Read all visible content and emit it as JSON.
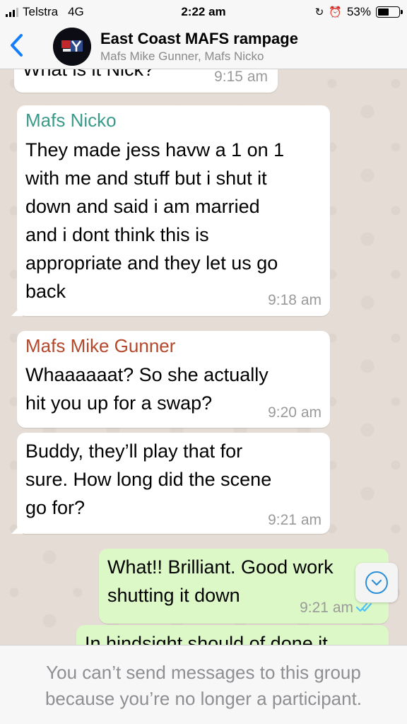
{
  "status_bar": {
    "carrier": "Telstra",
    "network": "4G",
    "time": "2:22 am",
    "battery_percent": "53%",
    "battery_level": 0.53,
    "icons": [
      "signal-icon",
      "rotation-lock-icon",
      "alarm-icon",
      "battery-icon"
    ]
  },
  "header": {
    "back_icon": "chevron-left-icon",
    "title": "East Coast MAFS rampage",
    "members": "Mafs Mike Gunner, Mafs Nicko"
  },
  "messages": [
    {
      "direction": "in",
      "sender": "",
      "text": "What is it Nick?",
      "time": "9:15 am"
    },
    {
      "direction": "in",
      "sender": "Mafs Nicko",
      "sender_color": "#3a9a8a",
      "text": "They made jess havw a 1 on 1\nwith me and stuff but i shut it\ndown and said i am married\nand i dont think this is\nappropriate and they let us go\nback",
      "time": "9:18 am"
    },
    {
      "direction": "in",
      "sender": "Mafs Mike Gunner",
      "sender_color": "#b5472a",
      "text": "Whaaaaaat? So she actually\nhit you up for a swap?",
      "time": "9:20 am"
    },
    {
      "direction": "in",
      "sender": "",
      "text": "Buddy, they’ll play that for\nsure. How long did the scene\ngo for?",
      "time": "9:21 am"
    },
    {
      "direction": "out",
      "sender": "",
      "text": "What!! Brilliant. Good work\nshutting it down",
      "time": "9:21 am",
      "status_icon": "double-check-read-icon"
    },
    {
      "direction": "out",
      "sender": "",
      "text": "In hindsight should of done it",
      "time": ""
    }
  ],
  "scroll_button_icon": "chevron-down-circle-icon",
  "footer": {
    "notice": "You can’t send messages to this group because you’re no longer a participant."
  },
  "colors": {
    "accent": "#147efb",
    "outgoing_bubble": "#dcf8c6",
    "incoming_bubble": "#ffffff",
    "read_ticks": "#4fc3f7"
  }
}
